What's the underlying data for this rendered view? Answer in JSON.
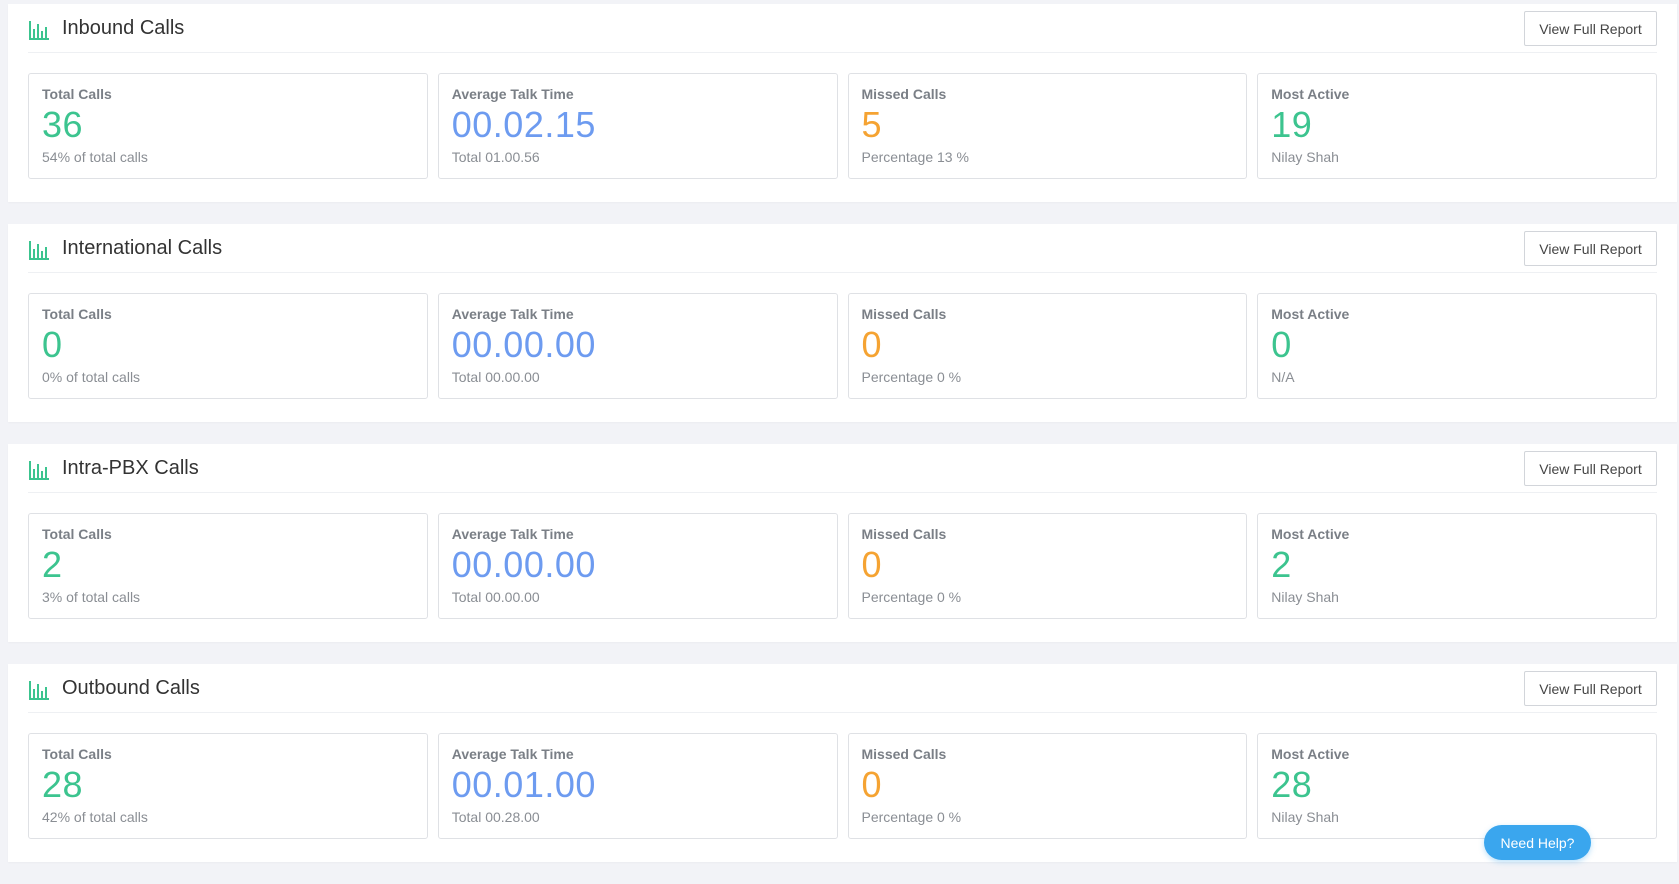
{
  "sections": [
    {
      "title": "Inbound Calls",
      "report_button": "View Full Report",
      "cards": [
        {
          "label": "Total Calls",
          "value": "36",
          "sub": "54% of total calls",
          "color": "green"
        },
        {
          "label": "Average Talk Time",
          "value": "00.02.15",
          "sub": "Total 01.00.56",
          "color": "blue"
        },
        {
          "label": "Missed Calls",
          "value": "5",
          "sub": "Percentage 13 %",
          "color": "orange"
        },
        {
          "label": "Most Active",
          "value": "19",
          "sub": "Nilay Shah",
          "color": "green"
        }
      ]
    },
    {
      "title": "International Calls",
      "report_button": "View Full Report",
      "cards": [
        {
          "label": "Total Calls",
          "value": "0",
          "sub": "0% of total calls",
          "color": "green"
        },
        {
          "label": "Average Talk Time",
          "value": "00.00.00",
          "sub": "Total 00.00.00",
          "color": "blue"
        },
        {
          "label": "Missed Calls",
          "value": "0",
          "sub": "Percentage 0 %",
          "color": "orange"
        },
        {
          "label": "Most Active",
          "value": "0",
          "sub": "N/A",
          "color": "green"
        }
      ]
    },
    {
      "title": "Intra-PBX Calls",
      "report_button": "View Full Report",
      "cards": [
        {
          "label": "Total Calls",
          "value": "2",
          "sub": "3% of total calls",
          "color": "green"
        },
        {
          "label": "Average Talk Time",
          "value": "00.00.00",
          "sub": "Total 00.00.00",
          "color": "blue"
        },
        {
          "label": "Missed Calls",
          "value": "0",
          "sub": "Percentage 0 %",
          "color": "orange"
        },
        {
          "label": "Most Active",
          "value": "2",
          "sub": "Nilay Shah",
          "color": "green"
        }
      ]
    },
    {
      "title": "Outbound Calls",
      "report_button": "View Full Report",
      "cards": [
        {
          "label": "Total Calls",
          "value": "28",
          "sub": "42% of total calls",
          "color": "green"
        },
        {
          "label": "Average Talk Time",
          "value": "00.01.00",
          "sub": "Total 00.28.00",
          "color": "blue"
        },
        {
          "label": "Missed Calls",
          "value": "0",
          "sub": "Percentage 0 %",
          "color": "orange"
        },
        {
          "label": "Most Active",
          "value": "28",
          "sub": "Nilay Shah",
          "color": "green"
        }
      ]
    }
  ],
  "help_button": "Need Help?",
  "colors": {
    "green": "#3cc48f",
    "blue": "#6d9bf0",
    "orange": "#f5a332",
    "help": "#3aa6ee"
  },
  "icons": {
    "section": "bar-chart-icon"
  }
}
